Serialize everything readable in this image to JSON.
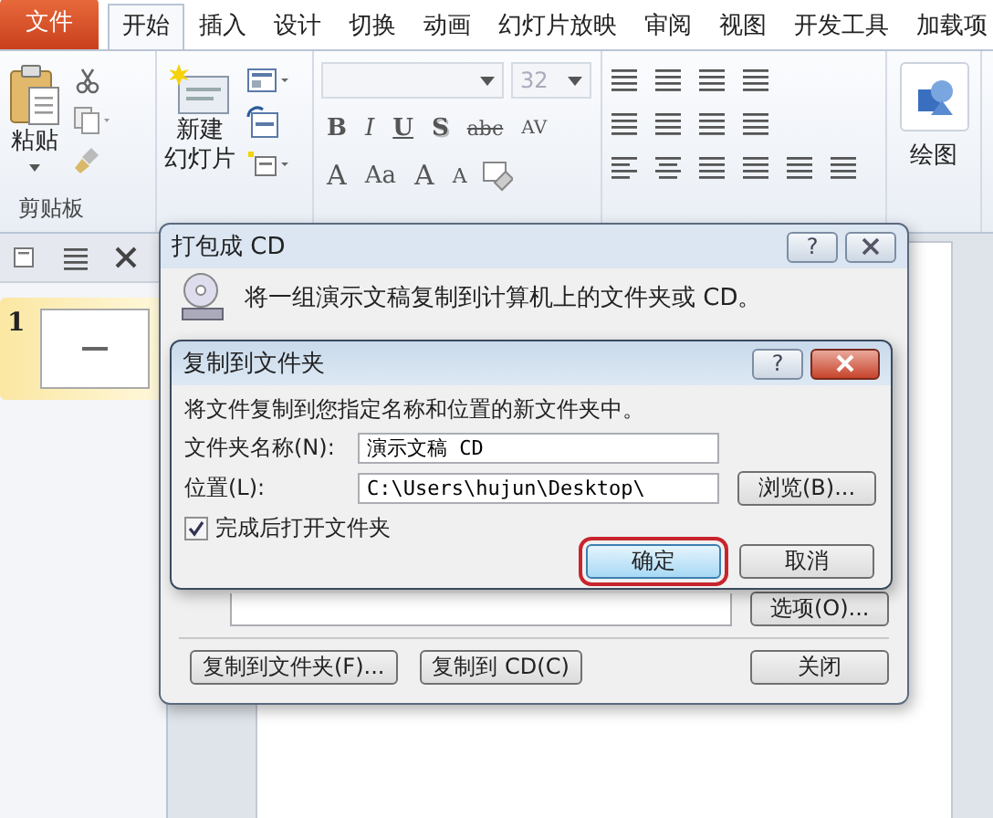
{
  "tabs": [
    {
      "label": "文件",
      "kind": "file",
      "selected": false
    },
    {
      "label": "开始",
      "kind": "tab",
      "selected": true
    },
    {
      "label": "插入",
      "kind": "tab",
      "selected": false
    },
    {
      "label": "设计",
      "kind": "tab",
      "selected": false
    },
    {
      "label": "切换",
      "kind": "tab",
      "selected": false
    },
    {
      "label": "动画",
      "kind": "tab",
      "selected": false
    },
    {
      "label": "幻灯片放映",
      "kind": "tab",
      "selected": false
    },
    {
      "label": "审阅",
      "kind": "tab",
      "selected": false
    },
    {
      "label": "视图",
      "kind": "tab",
      "selected": false
    },
    {
      "label": "开发工具",
      "kind": "tab",
      "selected": false
    },
    {
      "label": "加载项",
      "kind": "tab",
      "selected": false
    }
  ],
  "ribbon": {
    "clipboard": {
      "paste": "粘贴",
      "label": "剪贴板"
    },
    "slides": {
      "new_slide_line1": "新建",
      "new_slide_line2": "幻灯片"
    },
    "font": {
      "size": "32",
      "row1": [
        "B",
        "I",
        "U",
        "S",
        "abc",
        "AV"
      ],
      "row2": [
        "A",
        "Aa",
        "A",
        "A"
      ]
    },
    "drawing": {
      "label": "绘图"
    }
  },
  "slide_panel": {
    "thumbnails": [
      {
        "number": "1",
        "selected": true
      }
    ]
  },
  "package_dialog": {
    "title": "打包成 CD",
    "help": "?",
    "message": "将一组演示文稿复制到计算机上的文件夹或 CD。",
    "options_button": "选项(O)...",
    "buttons": [
      "复制到文件夹(F)...",
      "复制到 CD(C)",
      "关闭"
    ]
  },
  "copy_dialog": {
    "title": "复制到文件夹",
    "help": "?",
    "instruction": "将文件复制到您指定名称和位置的新文件夹中。",
    "fields": [
      {
        "label": "文件夹名称(N):",
        "value": "演示文稿 CD"
      },
      {
        "label": "位置(L):",
        "value": "C:\\Users\\hujun\\Desktop\\"
      }
    ],
    "browse_button": "浏览(B)...",
    "checkbox": {
      "label": "完成后打开文件夹",
      "checked": true
    },
    "buttons": [
      {
        "label": "确定",
        "highlighted": true
      },
      {
        "label": "取消",
        "highlighted": false
      }
    ]
  }
}
